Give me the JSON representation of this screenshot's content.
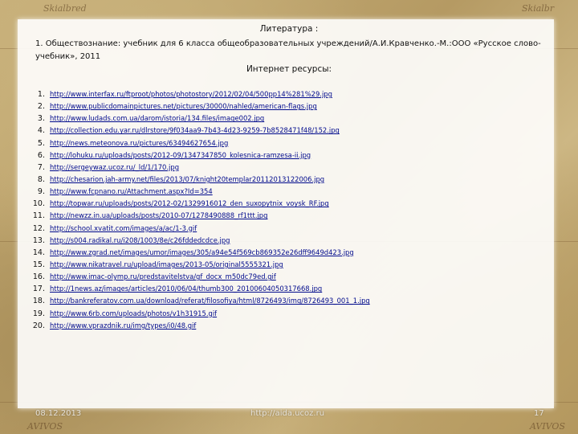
{
  "background_labels": {
    "top_left": "Skialbred",
    "top_right": "Skialbr",
    "bottom_left": "AVIVOS",
    "bottom_right": "AVIVOS"
  },
  "slide": {
    "title": "Литература :",
    "reference_1": "1. Обществознание: учебник для 6 класса общеобразовательных учреждений/А.И.Кравченко.-М.:ООО «Русское слово- учебник», 2011",
    "internet_heading": "Интернет ресурсы:",
    "links": [
      {
        "num": "1.",
        "url": "http://www.interfax.ru/ftproot/photos/photostory/2012/02/04/500pp14%281%29.jpg"
      },
      {
        "num": "2.",
        "url": "http://www.publicdomainpictures.net/pictures/30000/nahled/american-flags.jpg"
      },
      {
        "num": "3.",
        "url": "http://www.ludads.com.ua/darom/istoria/134.files/image002.jpg"
      },
      {
        "num": "4.",
        "url": "http://collection.edu.yar.ru/dlrstore/9f034aa9-7b43-4d23-9259-7b8528471f48/152.jpg"
      },
      {
        "num": "5.",
        "url": "http://news.meteonova.ru/pictures/63494627654.jpg"
      },
      {
        "num": "6.",
        "url": "http://lohuku.ru/uploads/posts/2012-09/1347347850_kolesnica-ramzesa-ii.jpg"
      },
      {
        "num": "7.",
        "url": "http://sergeywaz.ucoz.ru/_ld/1/170.jpg"
      },
      {
        "num": "8.",
        "url": "http://chesarion.jah-army.net/files/2013/07/knight20templar20112013122006.jpg"
      },
      {
        "num": "9.",
        "url": "http://www.fcpnano.ru/Attachment.aspx?Id=354"
      },
      {
        "num": "10.",
        "url": "http://topwar.ru/uploads/posts/2012-02/1329916012_den_suxopytnix_voysk_RF.jpg"
      },
      {
        "num": "11.",
        "url": "http://newzz.in.ua/uploads/posts/2010-07/1278490888_rf1ttt.jpg"
      },
      {
        "num": "12.",
        "url": "http://school.xvatit.com/images/a/ac/1-3.gif"
      },
      {
        "num": "13.",
        "url": "http://s004.radikal.ru/i208/1003/8e/c26fddedcdce.jpg"
      },
      {
        "num": "14.",
        "url": "http://www.zgrad.net/images/umor/images/305/a94e54f569cb869352e26dff9649d423.jpg"
      },
      {
        "num": "15.",
        "url": "http://www.nikatravel.ru/upload/images/2013-05/original5555321.jpg"
      },
      {
        "num": "16.",
        "url": "http://www.imac-olymp.ru/predstavitelstva/gf_docx_m50dc79ed.gif"
      },
      {
        "num": "17.",
        "url": "http://1news.az/images/articles/2010/06/04/thumb300_20100604050317668.jpg"
      },
      {
        "num": "18.",
        "url": "http://bankreferatov.com.ua/download/referat/filosofiya/html/8726493/img/8726493_001_1.jpg"
      },
      {
        "num": "19.",
        "url": "http://www.6rb.com/uploads/photos/v1h31915.gif"
      },
      {
        "num": "20.",
        "url": "http://www.vprazdnik.ru/img/types/i0/48.gif"
      }
    ]
  },
  "footer": {
    "date": "08.12.2013",
    "site": "http://aida.ucoz.ru",
    "page": "17"
  }
}
